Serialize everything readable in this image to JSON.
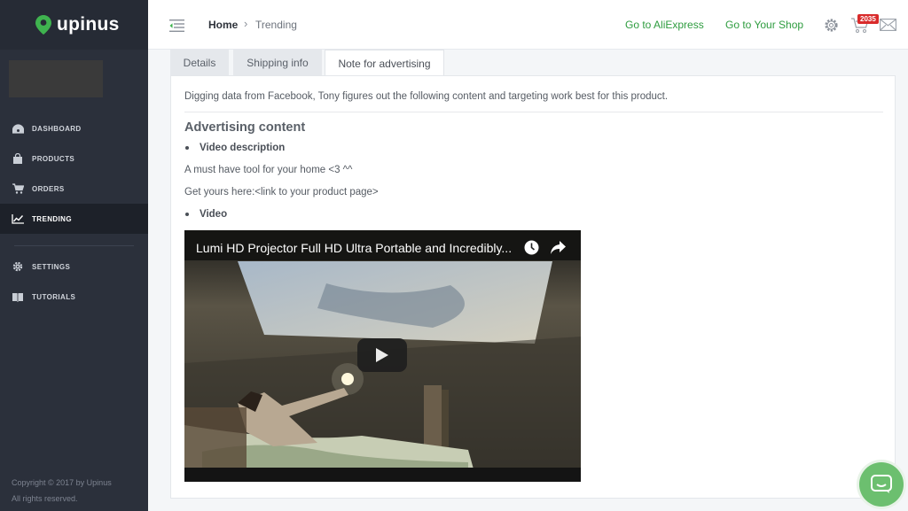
{
  "brand": {
    "name": "upinus",
    "accent": "#2e9c3f"
  },
  "sidebar": {
    "items": [
      {
        "label": "DASHBOARD",
        "icon": "dashboard-icon"
      },
      {
        "label": "PRODUCTS",
        "icon": "bag-icon"
      },
      {
        "label": "ORDERS",
        "icon": "cart-icon"
      },
      {
        "label": "TRENDING",
        "icon": "trend-chart-icon",
        "active": true
      },
      {
        "label": "SETTINGS",
        "icon": "gear-icon"
      },
      {
        "label": "TUTORIALS",
        "icon": "book-icon"
      }
    ],
    "copyright_line1": "Copyright © 2017 by Upinus",
    "copyright_line2": "All rights reserved."
  },
  "header": {
    "breadcrumb_home": "Home",
    "breadcrumb_sep": "›",
    "breadcrumb_current": "Trending",
    "link_aliexpress": "Go to AliExpress",
    "link_shop": "Go to Your Shop",
    "cart_badge": "2035"
  },
  "tabs": [
    {
      "label": "Details"
    },
    {
      "label": "Shipping info"
    },
    {
      "label": "Note for advertising",
      "active": true
    }
  ],
  "content": {
    "intro": "Digging data from Facebook, Tony figures out the following content and targeting work best for this product.",
    "section_title": "Advertising content",
    "bullet_video_description": "Video description",
    "desc_line1": "A must have tool for your home <3 ^^",
    "desc_line2": "Get yours here:<link to your product page>",
    "bullet_video": "Video",
    "video_title": "Lumi HD Projector Full HD Ultra Portable and Incredibly..."
  }
}
